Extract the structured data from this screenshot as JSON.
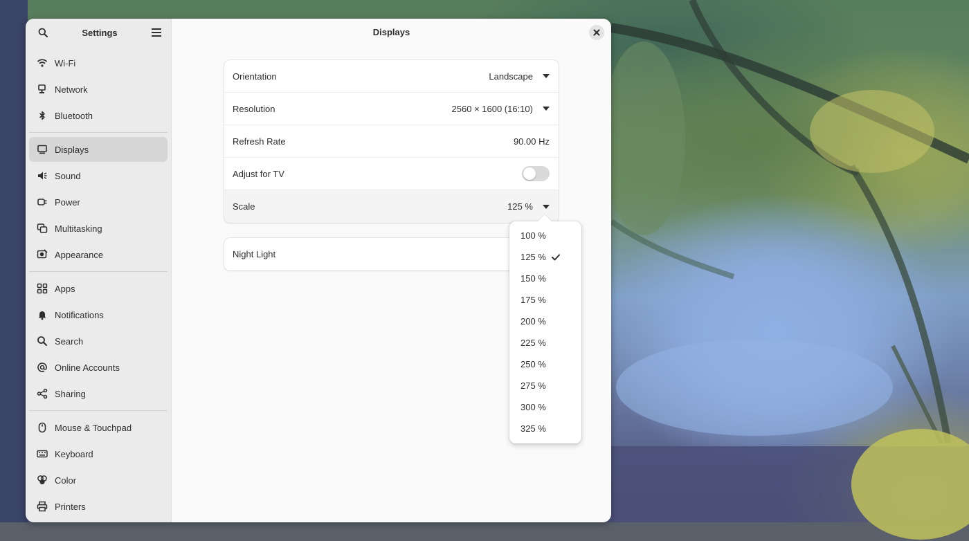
{
  "sidebar": {
    "title": "Settings",
    "groups": [
      [
        {
          "label": "Wi-Fi",
          "icon": "wifi-icon"
        },
        {
          "label": "Network",
          "icon": "network-icon"
        },
        {
          "label": "Bluetooth",
          "icon": "bluetooth-icon"
        }
      ],
      [
        {
          "label": "Displays",
          "icon": "display-icon",
          "selected": true
        },
        {
          "label": "Sound",
          "icon": "speaker-icon"
        },
        {
          "label": "Power",
          "icon": "power-plug-icon"
        },
        {
          "label": "Multitasking",
          "icon": "multitasking-icon"
        },
        {
          "label": "Appearance",
          "icon": "appearance-icon"
        }
      ],
      [
        {
          "label": "Apps",
          "icon": "apps-grid-icon"
        },
        {
          "label": "Notifications",
          "icon": "bell-icon"
        },
        {
          "label": "Search",
          "icon": "search-icon"
        },
        {
          "label": "Online Accounts",
          "icon": "at-icon"
        },
        {
          "label": "Sharing",
          "icon": "share-icon"
        }
      ],
      [
        {
          "label": "Mouse & Touchpad",
          "icon": "mouse-icon"
        },
        {
          "label": "Keyboard",
          "icon": "keyboard-icon"
        },
        {
          "label": "Color",
          "icon": "color-icon"
        },
        {
          "label": "Printers",
          "icon": "printer-icon"
        }
      ]
    ]
  },
  "content": {
    "title": "Displays",
    "settings": [
      {
        "label": "Orientation",
        "value": "Landscape",
        "control": "dropdown"
      },
      {
        "label": "Resolution",
        "value": "2560 × 1600 (16:10)",
        "control": "dropdown"
      },
      {
        "label": "Refresh Rate",
        "value": "90.00 Hz",
        "control": "text"
      },
      {
        "label": "Adjust for TV",
        "value": "",
        "control": "toggle",
        "on": false
      },
      {
        "label": "Scale",
        "value": "125 %",
        "control": "dropdown"
      }
    ],
    "night_light": {
      "label": "Night Light"
    }
  },
  "scale_popover": {
    "options": [
      "100 %",
      "125 %",
      "150 %",
      "175 %",
      "200 %",
      "225 %",
      "250 %",
      "275 %",
      "300 %",
      "325 %"
    ],
    "selected": "125 %"
  },
  "colors": {
    "sidebar_bg": "#ebebeb",
    "content_bg": "#fafafa",
    "selected_bg": "#d6d6d6",
    "text": "#2e2e2e"
  }
}
